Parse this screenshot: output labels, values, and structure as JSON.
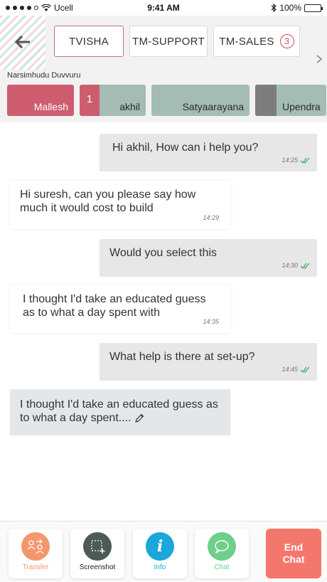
{
  "status_bar": {
    "carrier": "Ucell",
    "time": "9:41 AM",
    "battery": "100%"
  },
  "header": {
    "tabs": [
      {
        "label": "TVISHA"
      },
      {
        "label": "TM-SUPPORT"
      },
      {
        "label": "TM-SALES",
        "badge": "3"
      }
    ],
    "agent_name": "Narsimhudu Duvvuru",
    "agents": [
      {
        "name": "Mallesh"
      },
      {
        "count": "1",
        "name": "akhil"
      },
      {
        "name": "Satyaarayana"
      },
      {
        "name": "Upendra"
      }
    ]
  },
  "messages": [
    {
      "text": "Hi akhil, How can i help you?",
      "time": "14:25"
    },
    {
      "text": "Hi suresh, can you please say how much it would cost to build",
      "time": "14:29"
    },
    {
      "text": "Would you select this",
      "time": "14:30"
    },
    {
      "text": "I thought I'd take an educated guess as to what a day spent with",
      "time": "14:35"
    },
    {
      "text": "What help is there at set-up?",
      "time": "14:45"
    },
    {
      "text": "I thought I'd take an educated guess as to what a day spent...."
    }
  ],
  "actions": {
    "transfer": "Transfer",
    "screenshot": "Screenshot",
    "info": "Info",
    "chat": "Chat",
    "end_chat_line1": "End",
    "end_chat_line2": "Chat"
  },
  "colors": {
    "accent_red": "#cd5d6e",
    "agent_gray": "#a5bcb5",
    "transfer": "#f4976c",
    "screenshot": "#4d5b56",
    "info": "#1ba6dc",
    "chat": "#6dcf8b",
    "end_chat": "#f4776d"
  },
  "icons": [
    "back-arrow-icon",
    "chevron-right-icon",
    "double-check-icon",
    "pencil-icon",
    "transfer-icon",
    "screenshot-icon",
    "info-icon",
    "chat-bubble-icon"
  ]
}
